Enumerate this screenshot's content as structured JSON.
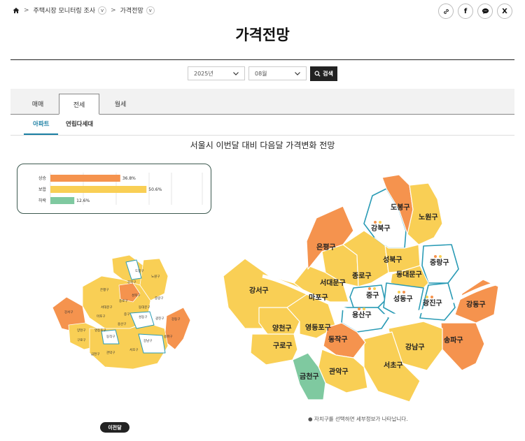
{
  "breadcrumb": {
    "item1": "주택시장 모니터링 조사",
    "item2": "가격전망"
  },
  "page": {
    "title": "가격전망"
  },
  "filters": {
    "year": "2025년",
    "month": "08월",
    "search_label": "검색"
  },
  "tabs": [
    {
      "label": "매매"
    },
    {
      "label": "전세"
    },
    {
      "label": "월세"
    }
  ],
  "subtabs": [
    {
      "label": "아파트"
    },
    {
      "label": "연립다세대"
    }
  ],
  "chart_title": "서울시 이번달 대비 다음달 가격변화 전망",
  "chart_data": {
    "type": "bar",
    "categories": [
      "상승",
      "보합",
      "하락"
    ],
    "values": [
      36.8,
      50.6,
      12.6
    ],
    "value_labels": [
      "36.8%",
      "50.6%",
      "12.6%"
    ],
    "colors": [
      "#f5934e",
      "#f9cf55",
      "#7fc9a0"
    ],
    "xlim": [
      0,
      80
    ]
  },
  "colors": {
    "rise": "#f5934e",
    "flat": "#f9cf55",
    "fall": "#7fc9a0",
    "highlight": "#2a9bb5"
  },
  "districts": {
    "dobong": "도봉구",
    "nowon": "노원구",
    "gangbuk": "강북구",
    "eunpyeong": "은평구",
    "seongbuk": "성북구",
    "jungnang": "중랑구",
    "jongno": "종로구",
    "dongdaemun": "동대문구",
    "seodaemun": "서대문구",
    "mapo": "마포구",
    "jung": "중구",
    "seongdong": "성동구",
    "gwangjin": "광진구",
    "gangdong": "강동구",
    "yongsan": "용산구",
    "gangseo": "강서구",
    "yangcheon": "양천구",
    "yeongdeungpo": "영등포구",
    "guro": "구로구",
    "dongjak": "동작구",
    "songpa": "송파구",
    "gangnam": "강남구",
    "seocho": "서초구",
    "geumcheon": "금천구",
    "gwanak": "관악구"
  },
  "note": "● 자치구를 선택하면 세부정보가 나타납니다.",
  "prev_label": "이전달"
}
